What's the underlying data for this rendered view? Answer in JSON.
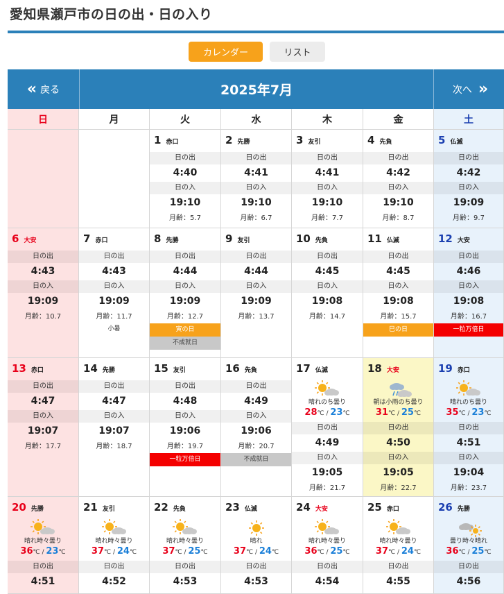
{
  "title": "愛知県瀬戸市の日の出・日の入り",
  "toggle": {
    "calendar": "カレンダー",
    "list": "リスト"
  },
  "nav": {
    "prev": "戻る",
    "next": "次へ",
    "prev_glyph": "«",
    "next_glyph": "»",
    "month": "2025年7月"
  },
  "labels": {
    "sunrise": "日の出",
    "sunset": "日の入"
  },
  "weekdays": [
    "日",
    "月",
    "火",
    "水",
    "木",
    "金",
    "土"
  ],
  "colors": {
    "accent": "#2b80b9",
    "active_toggle": "#f7a21b",
    "sunday_bg": "#fde2e2",
    "saturday_bg": "#e8f2fb",
    "today_bg": "#fbf7c6",
    "high_temp": "#e8001a",
    "low_temp": "#1a7fd8"
  },
  "weeks": [
    [
      {
        "empty": true
      },
      {
        "empty": true
      },
      {
        "day": "1",
        "rokuyo": "赤口",
        "sunrise": "4:40",
        "sunset": "19:10",
        "moon": "月齢：5.7"
      },
      {
        "day": "2",
        "rokuyo": "先勝",
        "sunrise": "4:41",
        "sunset": "19:10",
        "moon": "月齢：6.7"
      },
      {
        "day": "3",
        "rokuyo": "友引",
        "sunrise": "4:41",
        "sunset": "19:10",
        "moon": "月齢：7.7"
      },
      {
        "day": "4",
        "rokuyo": "先負",
        "sunrise": "4:42",
        "sunset": "19:10",
        "moon": "月齢：8.7"
      },
      {
        "day": "5",
        "rokuyo": "仏滅",
        "sunrise": "4:42",
        "sunset": "19:09",
        "moon": "月齢：9.7"
      }
    ],
    [
      {
        "day": "6",
        "rokuyo": "大安",
        "sunrise": "4:43",
        "sunset": "19:09",
        "moon": "月齢：10.7"
      },
      {
        "day": "7",
        "rokuyo": "赤口",
        "sunrise": "4:43",
        "sunset": "19:09",
        "moon": "月齢：11.7",
        "sekki": "小暑"
      },
      {
        "day": "8",
        "rokuyo": "先勝",
        "sunrise": "4:44",
        "sunset": "19:09",
        "moon": "月齢：12.7",
        "tags": [
          {
            "text": "寅の日",
            "color": "orange"
          },
          {
            "text": "不成就日",
            "color": "gray"
          }
        ]
      },
      {
        "day": "9",
        "rokuyo": "友引",
        "sunrise": "4:44",
        "sunset": "19:09",
        "moon": "月齢：13.7"
      },
      {
        "day": "10",
        "rokuyo": "先負",
        "sunrise": "4:45",
        "sunset": "19:08",
        "moon": "月齢：14.7"
      },
      {
        "day": "11",
        "rokuyo": "仏滅",
        "sunrise": "4:45",
        "sunset": "19:08",
        "moon": "月齢：15.7",
        "tags": [
          {
            "text": "巳の日",
            "color": "orange"
          }
        ]
      },
      {
        "day": "12",
        "rokuyo": "大安",
        "sunrise": "4:46",
        "sunset": "19:08",
        "moon": "月齢：16.7",
        "tags": [
          {
            "text": "一粒万倍日",
            "color": "red"
          }
        ]
      }
    ],
    [
      {
        "day": "13",
        "rokuyo": "赤口",
        "sunrise": "4:47",
        "sunset": "19:07",
        "moon": "月齢：17.7"
      },
      {
        "day": "14",
        "rokuyo": "先勝",
        "sunrise": "4:47",
        "sunset": "19:07",
        "moon": "月齢：18.7"
      },
      {
        "day": "15",
        "rokuyo": "友引",
        "sunrise": "4:48",
        "sunset": "19:06",
        "moon": "月齢：19.7",
        "tags": [
          {
            "text": "一粒万倍日",
            "color": "red"
          }
        ]
      },
      {
        "day": "16",
        "rokuyo": "先負",
        "sunrise": "4:49",
        "sunset": "19:06",
        "moon": "月齢：20.7",
        "tags": [
          {
            "text": "不成就日",
            "color": "gray"
          }
        ]
      },
      {
        "day": "17",
        "rokuyo": "仏滅",
        "weather": {
          "icon": "sun-cloud-icon",
          "text": "晴れのち曇り",
          "high": "28",
          "low": "23"
        },
        "sunrise": "4:49",
        "sunset": "19:05",
        "moon": "月齢：21.7"
      },
      {
        "day": "18",
        "rokuyo": "大安",
        "today": true,
        "weather": {
          "icon": "rain-cloud-icon",
          "text": "朝は小雨のち曇り",
          "high": "31",
          "low": "25"
        },
        "sunrise": "4:50",
        "sunset": "19:05",
        "moon": "月齢：22.7"
      },
      {
        "day": "19",
        "rokuyo": "赤口",
        "weather": {
          "icon": "sun-cloud-icon",
          "text": "晴れのち曇り",
          "high": "35",
          "low": "23"
        },
        "sunrise": "4:51",
        "sunset": "19:04",
        "moon": "月齢：23.7"
      }
    ],
    [
      {
        "day": "20",
        "rokuyo": "先勝",
        "weather": {
          "icon": "sun-cloud-icon",
          "text": "晴れ時々曇り",
          "high": "36",
          "low": "23"
        },
        "sunrise": "4:51"
      },
      {
        "day": "21",
        "rokuyo": "友引",
        "weather": {
          "icon": "sun-cloud-icon",
          "text": "晴れ時々曇り",
          "high": "37",
          "low": "24"
        },
        "sunrise": "4:52"
      },
      {
        "day": "22",
        "rokuyo": "先負",
        "weather": {
          "icon": "sun-cloud-icon",
          "text": "晴れ時々曇り",
          "high": "37",
          "low": "25"
        },
        "sunrise": "4:53"
      },
      {
        "day": "23",
        "rokuyo": "仏滅",
        "weather": {
          "icon": "sun-icon",
          "text": "晴れ",
          "high": "37",
          "low": "24"
        },
        "sunrise": "4:53"
      },
      {
        "day": "24",
        "rokuyo": "大安",
        "weather": {
          "icon": "sun-cloud-icon",
          "text": "晴れ時々曇り",
          "high": "36",
          "low": "25"
        },
        "sunrise": "4:54"
      },
      {
        "day": "25",
        "rokuyo": "赤口",
        "weather": {
          "icon": "sun-cloud-icon",
          "text": "晴れ時々曇り",
          "high": "37",
          "low": "24"
        },
        "sunrise": "4:55"
      },
      {
        "day": "26",
        "rokuyo": "先勝",
        "weather": {
          "icon": "cloud-sun-icon",
          "text": "曇り時々晴れ",
          "high": "36",
          "low": "25"
        },
        "sunrise": "4:56"
      }
    ]
  ]
}
